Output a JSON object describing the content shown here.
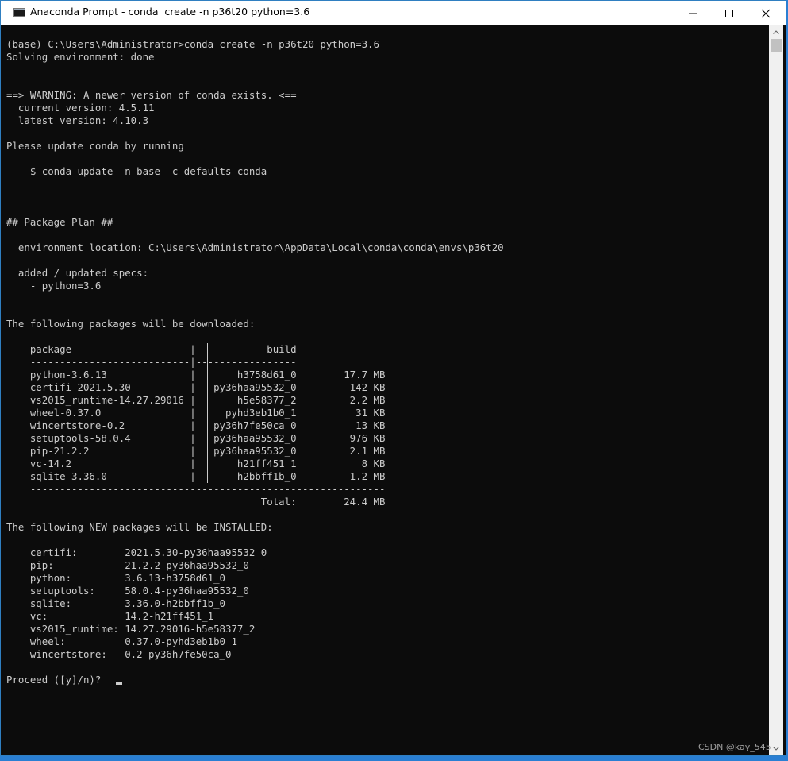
{
  "window": {
    "title": "Anaconda Prompt - conda  create -n p36t20 python=3.6",
    "icon": "console-icon"
  },
  "console": {
    "lines": [
      "(base) C:\\Users\\Administrator>conda create -n p36t20 python=3.6",
      "Solving environment: done",
      "",
      "",
      "==> WARNING: A newer version of conda exists. <==",
      "  current version: 4.5.11",
      "  latest version: 4.10.3",
      "",
      "Please update conda by running",
      "",
      "    $ conda update -n base -c defaults conda",
      "",
      "",
      "",
      "## Package Plan ##",
      "",
      "  environment location: C:\\Users\\Administrator\\AppData\\Local\\conda\\conda\\envs\\p36t20",
      "",
      "  added / updated specs:",
      "    - python=3.6",
      "",
      "",
      "The following packages will be downloaded:",
      "",
      "    package                    |            build",
      "    ---------------------------|-----------------",
      "    python-3.6.13              |       h3758d61_0        17.7 MB",
      "    certifi-2021.5.30          |   py36haa95532_0         142 KB",
      "    vs2015_runtime-14.27.29016 |       h5e58377_2         2.2 MB",
      "    wheel-0.37.0               |     pyhd3eb1b0_1          31 KB",
      "    wincertstore-0.2           |   py36h7fe50ca_0          13 KB",
      "    setuptools-58.0.4          |   py36haa95532_0         976 KB",
      "    pip-21.2.2                 |   py36haa95532_0         2.1 MB",
      "    vc-14.2                    |       h21ff451_1           8 KB",
      "    sqlite-3.36.0              |       h2bbff1b_0         1.2 MB",
      "    ------------------------------------------------------------",
      "                                           Total:        24.4 MB",
      "",
      "The following NEW packages will be INSTALLED:",
      "",
      "    certifi:        2021.5.30-py36haa95532_0",
      "    pip:            21.2.2-py36haa95532_0",
      "    python:         3.6.13-h3758d61_0",
      "    setuptools:     58.0.4-py36haa95532_0",
      "    sqlite:         3.36.0-h2bbff1b_0",
      "    vc:             14.2-h21ff451_1",
      "    vs2015_runtime: 14.27.29016-h5e58377_2",
      "    wheel:          0.37.0-pyhd3eb1b0_1",
      "    wincertstore:   0.2-py36h7fe50ca_0",
      "",
      "Proceed ([y]/n)? "
    ]
  },
  "watermark": "CSDN @kay_545",
  "colors": {
    "console_bg": "#0c0c0c",
    "console_text": "#cccccc",
    "titlebar_bg": "#ffffff",
    "desktop_border": "#2a7fd3"
  }
}
